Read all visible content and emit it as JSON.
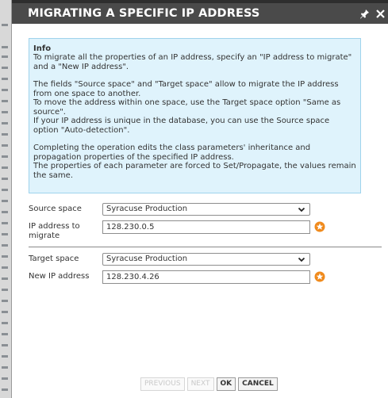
{
  "dialog": {
    "title": "MIGRATING A SPECIFIC IP ADDRESS",
    "pin_icon": "pin-icon",
    "close_icon": "close-icon"
  },
  "info": {
    "heading": "Info",
    "p1": "To migrate all the properties of an IP address, specify an \"IP address to migrate\" and a \"New IP address\".",
    "p2": "The fields \"Source space\" and \"Target space\" allow to migrate the IP address from one space to another.",
    "p3": "To move the address within one space, use the Target space option \"Same as source\".",
    "p4": "If your IP address is unique in the database, you can use the Source space option \"Auto-detection\".",
    "p5": "Completing the operation edits the class parameters' inheritance and propagation properties of the specified IP address.",
    "p6": "The properties of each parameter are forced to Set/Propagate, the values remain the same."
  },
  "form": {
    "source_space_label": "Source space",
    "source_space_value": "Syracuse Production",
    "ip_to_migrate_label": "IP address to migrate",
    "ip_to_migrate_value": "128.230.0.5",
    "target_space_label": "Target space",
    "target_space_value": "Syracuse Production",
    "new_ip_label": "New IP address",
    "new_ip_value": "128.230.4.26"
  },
  "buttons": {
    "previous": "PREVIOUS",
    "next": "NEXT",
    "ok": "OK",
    "cancel": "CANCEL"
  },
  "colors": {
    "titlebar": "#4a4a4a",
    "info_bg": "#dff3fc",
    "info_border": "#9fd3ec",
    "star": "#f08a1c"
  }
}
